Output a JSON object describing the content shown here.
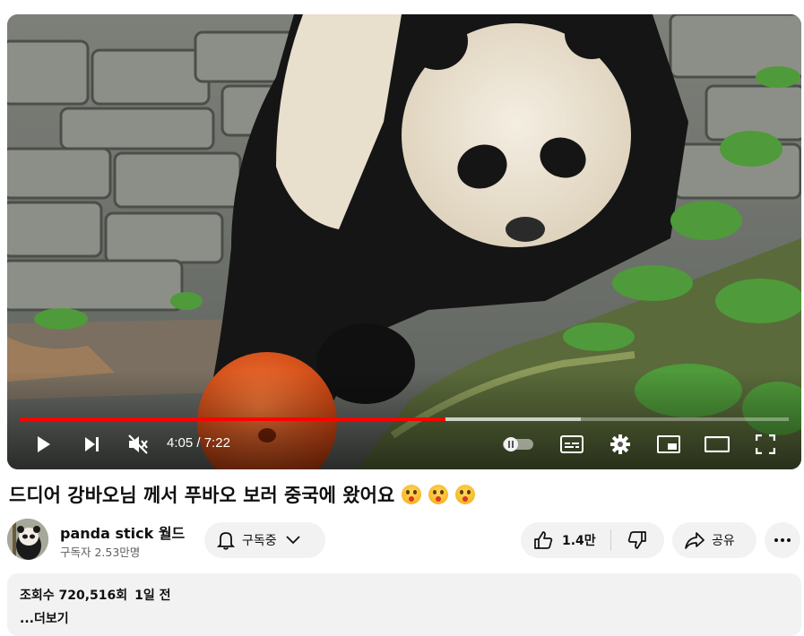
{
  "player": {
    "time_current": "4:05",
    "time_separator": " / ",
    "time_total": "7:22",
    "progress_played": 0.554,
    "progress_buffered": 0.73,
    "muted": true,
    "accent_color": "#ff0000"
  },
  "video": {
    "title": "드디어 강바오님 께서 푸바오 보러 중국에 왔어요",
    "title_emojis": [
      "astonished-face",
      "astonished-face",
      "astonished-face"
    ]
  },
  "channel": {
    "name": "panda stick 월드",
    "subscribers": "구독자 2.53만명"
  },
  "actions": {
    "subscribe_label": "구독중",
    "like_count": "1.4만",
    "share_label": "공유"
  },
  "description": {
    "views": "조회수 720,516회",
    "age": "1일 전",
    "more_label": "...더보기"
  },
  "icons": [
    "play-icon",
    "next-icon",
    "mute-icon",
    "autoplay-toggle-icon",
    "subtitles-icon",
    "settings-gear-icon",
    "miniplayer-icon",
    "theater-mode-icon",
    "fullscreen-icon",
    "bell-icon",
    "chevron-down-icon",
    "thumbs-up-icon",
    "thumbs-down-icon",
    "share-icon",
    "more-icon"
  ]
}
